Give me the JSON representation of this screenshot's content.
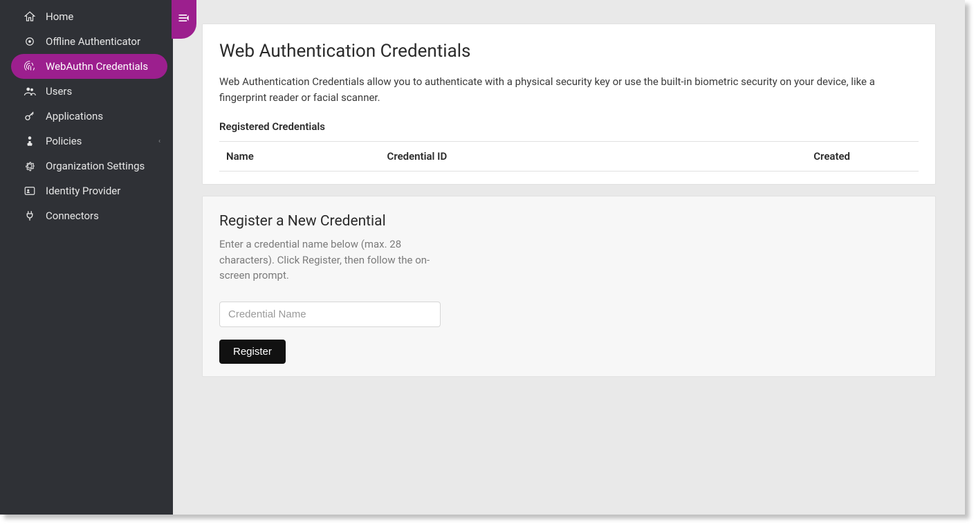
{
  "sidebar": {
    "items": [
      {
        "label": "Home",
        "icon": "home-icon"
      },
      {
        "label": "Offline Authenticator",
        "icon": "offline-icon"
      },
      {
        "label": "WebAuthn Credentials",
        "icon": "fingerprint-icon",
        "active": true
      },
      {
        "label": "Users",
        "icon": "users-icon"
      },
      {
        "label": "Applications",
        "icon": "key-icon"
      },
      {
        "label": "Policies",
        "icon": "policies-icon",
        "hasSubmenu": true
      },
      {
        "label": "Organization Settings",
        "icon": "gear-icon"
      },
      {
        "label": "Identity Provider",
        "icon": "idp-icon"
      },
      {
        "label": "Connectors",
        "icon": "plug-icon"
      }
    ]
  },
  "main": {
    "title": "Web Authentication Credentials",
    "description": "Web Authentication Credentials allow you to authenticate with a physical security key or use the built-in biometric security on your device, like a fingerprint reader or facial scanner.",
    "registered_heading": "Registered Credentials",
    "table": {
      "columns": [
        "Name",
        "Credential ID",
        "Created"
      ],
      "rows": []
    },
    "register": {
      "title": "Register a New Credential",
      "helper": "Enter a credential name below (max. 28 characters). Click Register, then follow the on-screen prompt.",
      "placeholder": "Credential Name",
      "value": "",
      "button_label": "Register"
    }
  },
  "colors": {
    "accent": "#9c1f8e",
    "sidebar_bg": "#2f3136"
  }
}
